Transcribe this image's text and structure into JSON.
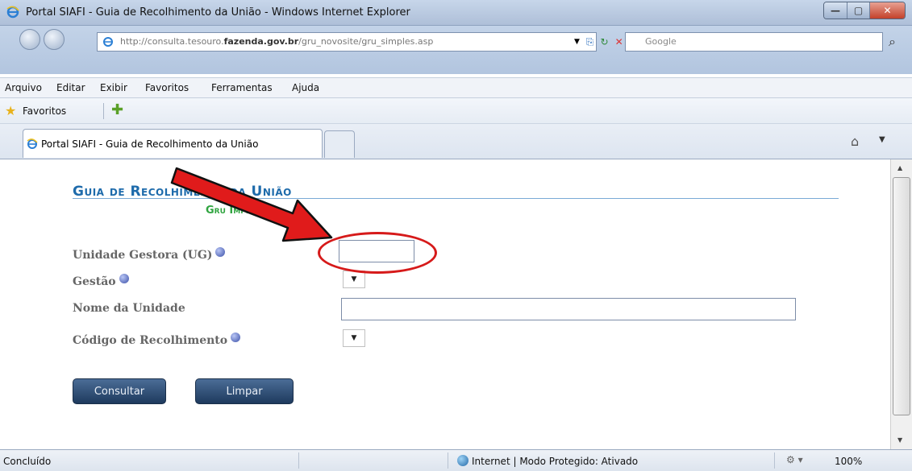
{
  "window": {
    "title": "Portal SIAFI - Guia de Recolhimento da União - Windows Internet Explorer",
    "minimize": "—",
    "maximize": "▢",
    "close": "✕"
  },
  "addressbar": {
    "url_prefix": "http://consulta.tesouro.",
    "url_domain": "fazenda.gov.br",
    "url_path": "/gru_novosite/gru_simples.asp",
    "search_placeholder": "Google"
  },
  "menu": {
    "items": [
      "Arquivo",
      "Editar",
      "Exibir",
      "Favoritos",
      "Ferramentas",
      "Ajuda"
    ]
  },
  "favorites": {
    "label": "Favoritos"
  },
  "tabs": [
    {
      "label": "Portal SIAFI - Guia de Recolhimento da União"
    }
  ],
  "page": {
    "heading": "Guia de Recolhimento da União",
    "subheading": "Gru Impressão",
    "fields": {
      "ug_label": "Unidade Gestora (UG)",
      "gestao_label": "Gestão",
      "nome_label": "Nome da Unidade",
      "codigo_label": "Código de Recolhimento"
    },
    "buttons": {
      "consultar": "Consultar",
      "limpar": "Limpar"
    }
  },
  "status": {
    "text": "Concluído",
    "zone": "Internet | Modo Protegido: Ativado",
    "zoom": "100%"
  },
  "annotation_colors": {
    "arrow": "#e01b1b",
    "circle": "#d61a1a"
  },
  "icons": [
    "ie-logo-icon",
    "back-icon",
    "forward-icon",
    "refresh-icon",
    "stop-icon",
    "search-icon",
    "star-icon",
    "add-favorite-icon",
    "home-icon",
    "help-icon",
    "globe-icon",
    "arrow-annotation-icon"
  ]
}
